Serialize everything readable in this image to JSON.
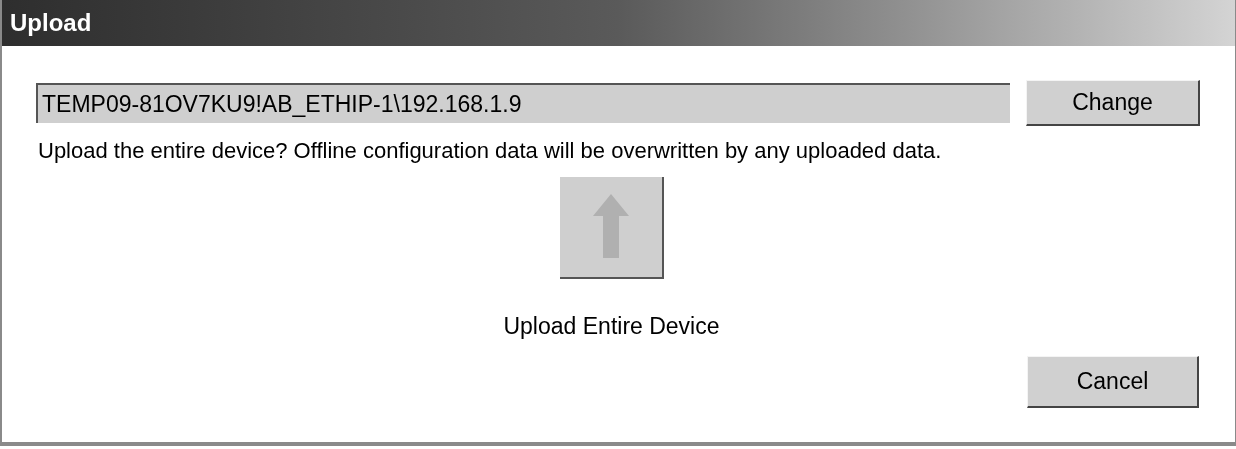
{
  "window": {
    "title": "Upload"
  },
  "path_field": {
    "value": "TEMP09-81OV7KU9!AB_ETHIP-1\\192.168.1.9"
  },
  "change_button": {
    "label": "Change"
  },
  "message": "Upload the entire device? Offline configuration data will be overwritten by any uploaded data.",
  "upload_button": {
    "label": "Upload Entire Device",
    "disabled": true
  },
  "cancel_button": {
    "label": "Cancel"
  }
}
